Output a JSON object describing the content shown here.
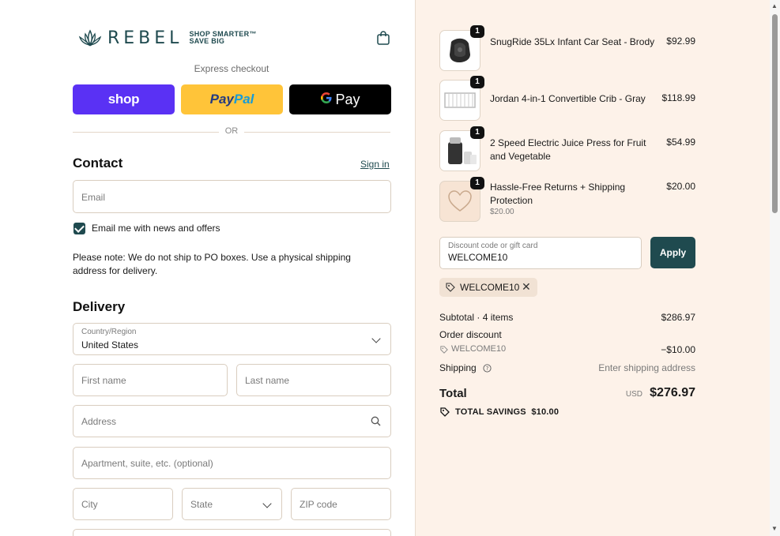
{
  "brand": {
    "name": "REBEL",
    "tagline_line1": "SHOP SMARTER",
    "tagline_mark": "™",
    "tagline_line2": "SAVE BIG",
    "color": "#1f4a4f"
  },
  "express": {
    "label": "Express checkout",
    "shop_label": "shop",
    "paypal_label_pay": "Pay",
    "paypal_label_pal": "Pal",
    "gpay_g": "G",
    "gpay_label": "Pay",
    "or_label": "OR"
  },
  "contact": {
    "heading": "Contact",
    "sign_in": "Sign in",
    "email_placeholder": "Email",
    "newsletter_label": "Email me with news and offers",
    "newsletter_checked": true,
    "note": "Please note: We do not ship to PO boxes. Use a physical shipping address for delivery."
  },
  "delivery": {
    "heading": "Delivery",
    "country_label": "Country/Region",
    "country_value": "United States",
    "first_name_placeholder": "First name",
    "last_name_placeholder": "Last name",
    "address_placeholder": "Address",
    "apartment_placeholder": "Apartment, suite, etc. (optional)",
    "city_placeholder": "City",
    "state_placeholder": "State",
    "zip_placeholder": "ZIP code"
  },
  "order": {
    "items": [
      {
        "name": "SnugRide 35Lx Infant Car Seat - Brody",
        "price": "$92.99",
        "qty": "1",
        "sub": ""
      },
      {
        "name": "Jordan 4-in-1 Convertible Crib - Gray",
        "price": "$118.99",
        "qty": "1",
        "sub": ""
      },
      {
        "name": "2 Speed Electric Juice Press for Fruit and Vegetable",
        "price": "$54.99",
        "qty": "1",
        "sub": ""
      },
      {
        "name": "Hassle-Free Returns + Shipping Protection",
        "price": "$20.00",
        "qty": "1",
        "sub": "$20.00"
      }
    ],
    "discount_label": "Discount code or gift card",
    "discount_value": "WELCOME10",
    "apply_label": "Apply",
    "applied_code": "WELCOME10",
    "subtotal_label": "Subtotal · 4 items",
    "subtotal_value": "$286.97",
    "order_discount_label": "Order discount",
    "order_discount_code": "WELCOME10",
    "order_discount_value": "−$10.00",
    "shipping_label": "Shipping",
    "shipping_value": "Enter shipping address",
    "total_label": "Total",
    "currency": "USD",
    "total_value": "$276.97",
    "savings_label": "TOTAL SAVINGS",
    "savings_value": "$10.00",
    "background": "#fdf2e9"
  }
}
